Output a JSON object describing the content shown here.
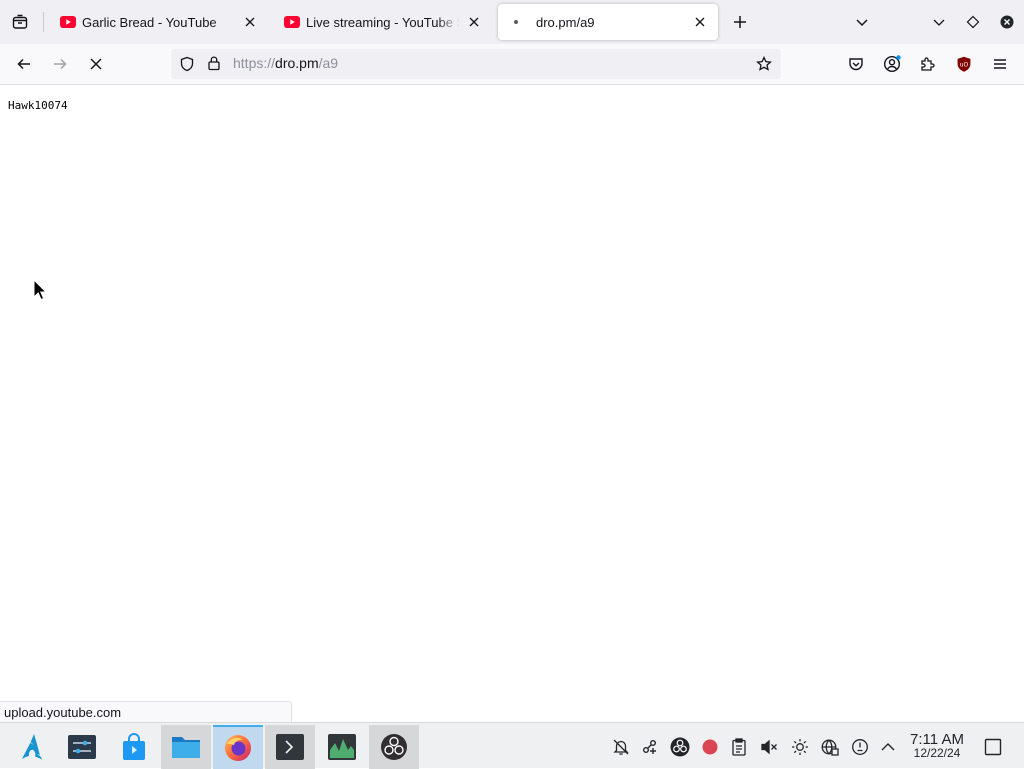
{
  "browser": {
    "tabs": [
      {
        "title": "Garlic Bread - YouTube",
        "favicon": "youtube-icon",
        "active": false
      },
      {
        "title": "Live streaming - YouTube Studio",
        "favicon": "youtube-icon",
        "active": false
      },
      {
        "title": "dro.pm/a9",
        "favicon": "loading-dot-icon",
        "active": true
      }
    ],
    "url": {
      "scheme": "https://",
      "host": "dro.pm",
      "path": "/a9"
    },
    "status_tooltip": "upload.youtube.com"
  },
  "page": {
    "text": "Hawk10074"
  },
  "taskbar": {
    "apps": [
      {
        "name": "app-launcher",
        "icon": "arch-linux-icon"
      },
      {
        "name": "system-settings",
        "icon": "settings-sliders-icon"
      },
      {
        "name": "discover",
        "icon": "discover-store-icon"
      },
      {
        "name": "dolphin",
        "icon": "folder-icon"
      },
      {
        "name": "firefox",
        "icon": "firefox-icon"
      },
      {
        "name": "konsole",
        "icon": "terminal-icon"
      },
      {
        "name": "system-monitor",
        "icon": "system-monitor-icon"
      },
      {
        "name": "obs",
        "icon": "obs-icon"
      }
    ],
    "clock": {
      "time": "7:11 AM",
      "date": "12/22/24"
    }
  },
  "colors": {
    "tab_strip_bg": "#f0f0f4",
    "youtube_red": "#ff0033",
    "ublock_red": "#800000",
    "taskbar_bg": "#eff0f1",
    "accent_blue": "#3daee9"
  }
}
